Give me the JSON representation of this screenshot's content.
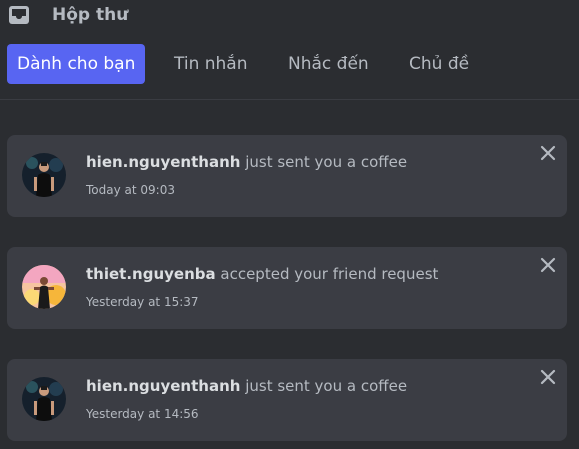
{
  "header": {
    "title": "Hộp thư",
    "icon": "inbox-icon"
  },
  "tabs": [
    {
      "label": "Dành cho bạn",
      "active": true
    },
    {
      "label": "Tin nhắn",
      "active": false
    },
    {
      "label": "Nhắc đến",
      "active": false
    },
    {
      "label": "Chủ đề",
      "active": false
    }
  ],
  "notifications": [
    {
      "username": "hien.nguyenthanh",
      "action": " just sent you a coffee",
      "timestamp": "Today at 09:03",
      "avatar": "avatar-dark"
    },
    {
      "username": "thiet.nguyenba",
      "action": " accepted your friend request",
      "timestamp": "Yesterday at 15:37",
      "avatar": "avatar-pink"
    },
    {
      "username": "hien.nguyenthanh",
      "action": " just sent you a coffee",
      "timestamp": "Yesterday at 14:56",
      "avatar": "avatar-dark"
    }
  ],
  "colors": {
    "background": "#2b2d31",
    "card": "#3b3d44",
    "accent": "#5865f2",
    "muted_text": "#b5bac1",
    "strong_text": "#dbdee1"
  }
}
